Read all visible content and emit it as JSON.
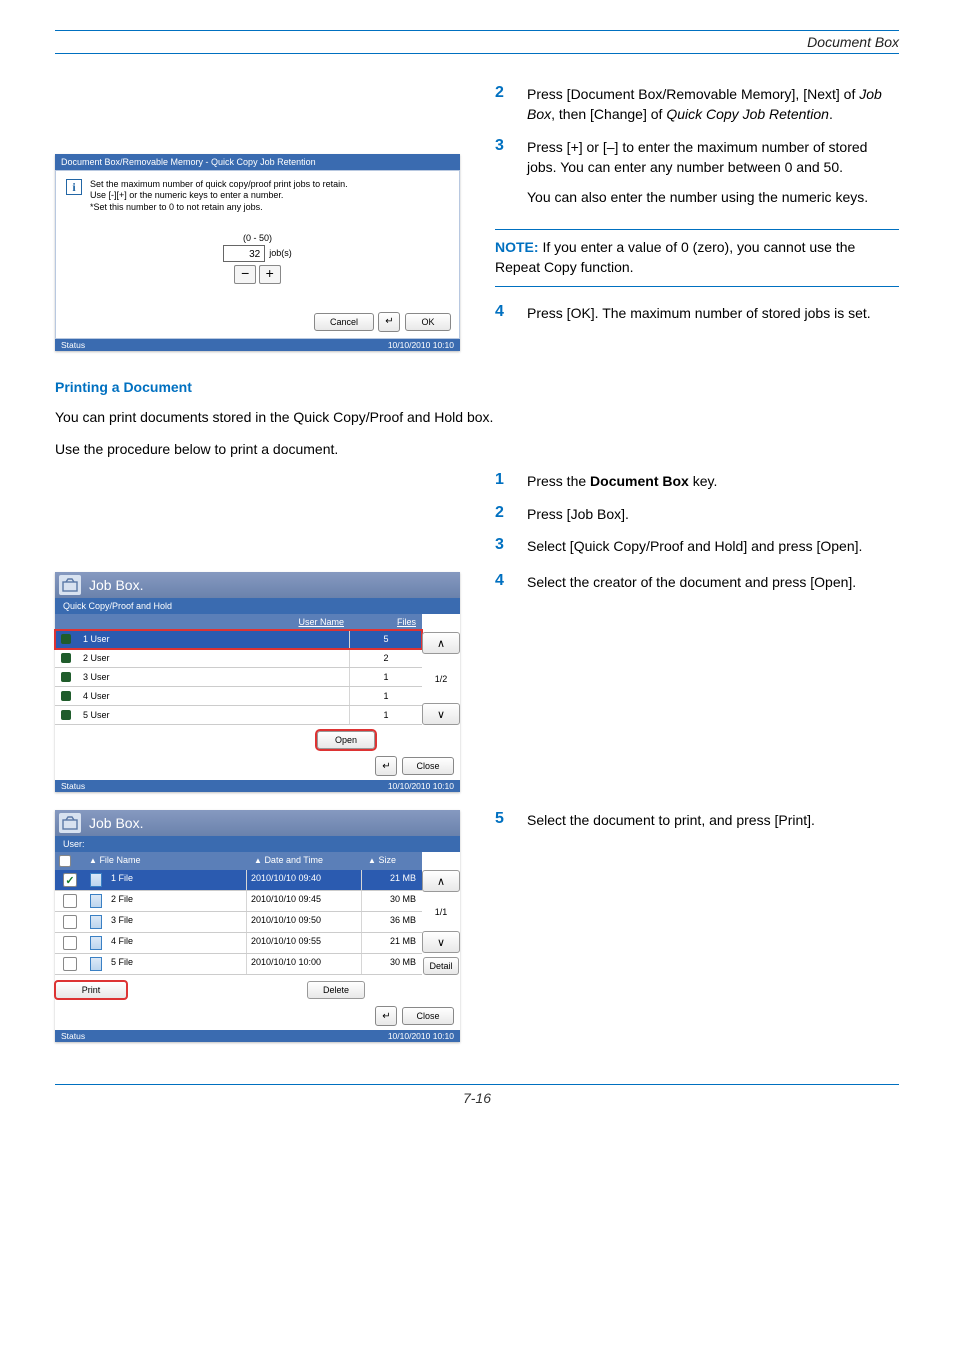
{
  "header": {
    "doc_title": "Document Box"
  },
  "steps_a": [
    {
      "n": "2",
      "html": "Press [Document Box/Removable Memory], [Next] of <i>Job Box</i>, then [Change] of <i>Quick Copy Job Retention</i>."
    },
    {
      "n": "3",
      "html": "Press [+] or [–] to enter the maximum number of stored jobs. You can enter any number between 0 and 50."
    },
    {
      "extra": "You can also enter the number using the numeric keys."
    }
  ],
  "note": {
    "label": "NOTE:",
    "text": " If you enter a value of 0 (zero), you cannot use the Repeat Copy function."
  },
  "step4": {
    "n": "4",
    "text": "Press [OK]. The maximum number of stored jobs is set."
  },
  "section": "Printing a Document",
  "intro1": "You can print documents stored in the Quick Copy/Proof and Hold box.",
  "intro2": "Use the procedure below to print a document.",
  "steps_b": [
    {
      "n": "1",
      "html": "Press the <b>Document Box</b> key."
    },
    {
      "n": "2",
      "html": "Press [Job Box]."
    },
    {
      "n": "3",
      "html": "Select [Quick Copy/Proof and Hold] and press [Open]."
    },
    {
      "n": "4",
      "html": "Select the creator of the document and press [Open]."
    },
    {
      "n": "5",
      "html": "Select the document to print, and press [Print]."
    }
  ],
  "panel1": {
    "title": "Document Box/Removable Memory - Quick Copy Job Retention",
    "msg1": "Set the maximum number of quick copy/proof print jobs to retain.",
    "msg2": "Use [-][+] or the numeric keys to enter a number.",
    "msg3": "*Set this number to 0 to not retain any jobs.",
    "range": "(0 - 50)",
    "value": "32",
    "unit": "job(s)",
    "cancel": "Cancel",
    "ok": "OK",
    "status": "Status",
    "timestamp": "10/10/2010  10:10"
  },
  "panel2": {
    "title": "Job Box.",
    "subtitle": "Quick Copy/Proof and Hold",
    "col_user": "User Name",
    "col_files": "Files",
    "rows": [
      {
        "name": "1 User",
        "files": "5",
        "sel": true
      },
      {
        "name": "2 User",
        "files": "2"
      },
      {
        "name": "3 User",
        "files": "1"
      },
      {
        "name": "4 User",
        "files": "1"
      },
      {
        "name": "5 User",
        "files": "1"
      }
    ],
    "pager": "1/2",
    "open": "Open",
    "close": "Close",
    "status": "Status",
    "timestamp": "10/10/2010  10:10"
  },
  "panel3": {
    "title": "Job Box.",
    "user_label": "User:",
    "col_fname": "File Name",
    "col_date": "Date and Time",
    "col_size": "Size",
    "rows": [
      {
        "name": "1 File",
        "date": "2010/10/10 09:40",
        "size": "21 MB",
        "checked": true,
        "sel": true
      },
      {
        "name": "2 File",
        "date": "2010/10/10 09:45",
        "size": "30 MB"
      },
      {
        "name": "3 File",
        "date": "2010/10/10 09:50",
        "size": "36 MB"
      },
      {
        "name": "4 File",
        "date": "2010/10/10 09:55",
        "size": "21 MB"
      },
      {
        "name": "5 File",
        "date": "2010/10/10 10:00",
        "size": "30 MB"
      }
    ],
    "pager": "1/1",
    "detail": "Detail",
    "print": "Print",
    "del": "Delete",
    "close": "Close",
    "status": "Status",
    "timestamp": "10/10/2010  10:10"
  },
  "page_num": "7-16"
}
